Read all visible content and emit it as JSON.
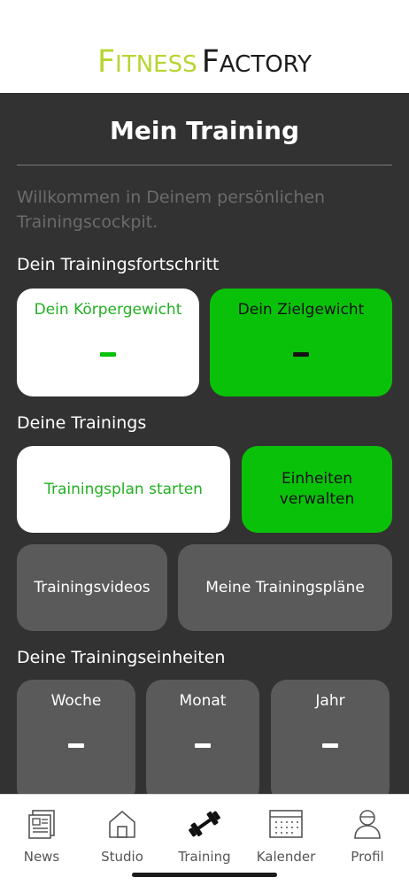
{
  "brand": {
    "fitness_initial": "F",
    "fitness_rest": "ITNESS",
    "factory_initial": "F",
    "factory_rest": "ACTORY"
  },
  "header": {
    "title": "Mein Training"
  },
  "welcome_text": "Willkommen in Deinem persönlichen Trainingscockpit.",
  "progress": {
    "section_title": "Dein Trainingsfortschritt",
    "body_weight": {
      "label": "Dein Körpergewicht",
      "value": "-"
    },
    "target_weight": {
      "label": "Dein Zielgewicht",
      "value": "-"
    }
  },
  "trainings": {
    "section_title": "Deine Trainings",
    "start_plan": "Trainingsplan starten",
    "manage_units": "Einheiten verwalten",
    "videos": "Trainingsvideos",
    "my_plans": "Meine Trainingspläne"
  },
  "units": {
    "section_title": "Deine Trainingseinheiten",
    "week": {
      "label": "Woche",
      "value": "-"
    },
    "month": {
      "label": "Monat",
      "value": "-"
    },
    "year": {
      "label": "Jahr",
      "value": "-"
    }
  },
  "tabbar": {
    "items": [
      {
        "label": "News",
        "icon": "news-icon"
      },
      {
        "label": "Studio",
        "icon": "home-icon"
      },
      {
        "label": "Training",
        "icon": "dumbbell-icon",
        "active": true
      },
      {
        "label": "Kalender",
        "icon": "calendar-icon"
      },
      {
        "label": "Profil",
        "icon": "profile-icon"
      }
    ]
  },
  "colors": {
    "accent_green": "#0ac10a",
    "brand_lime": "#b7d531",
    "panel_background": "#333232",
    "tile_grey": "#5b5a5a"
  }
}
